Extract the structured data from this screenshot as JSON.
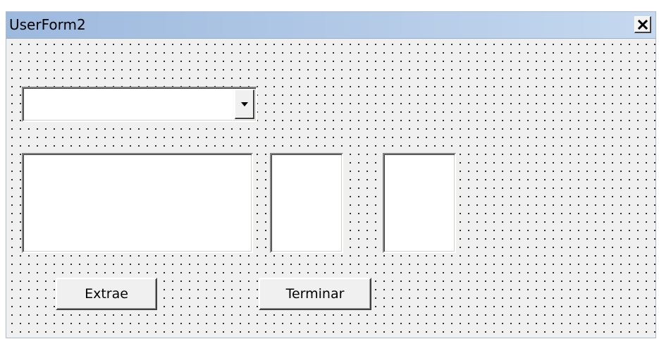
{
  "window": {
    "title": "UserForm2",
    "close_glyph": "✕"
  },
  "combo": {
    "value": "",
    "arrow_icon": "triangle-down"
  },
  "lists": [
    {
      "items": []
    },
    {
      "items": []
    },
    {
      "items": []
    }
  ],
  "buttons": {
    "extrae_label": "Extrae",
    "terminar_label": "Terminar"
  },
  "colors": {
    "title_gradient_start": "#9db9de",
    "title_gradient_end": "#c5d8ef",
    "form_background": "#f0f0f0",
    "grid_dot": "#000000"
  }
}
